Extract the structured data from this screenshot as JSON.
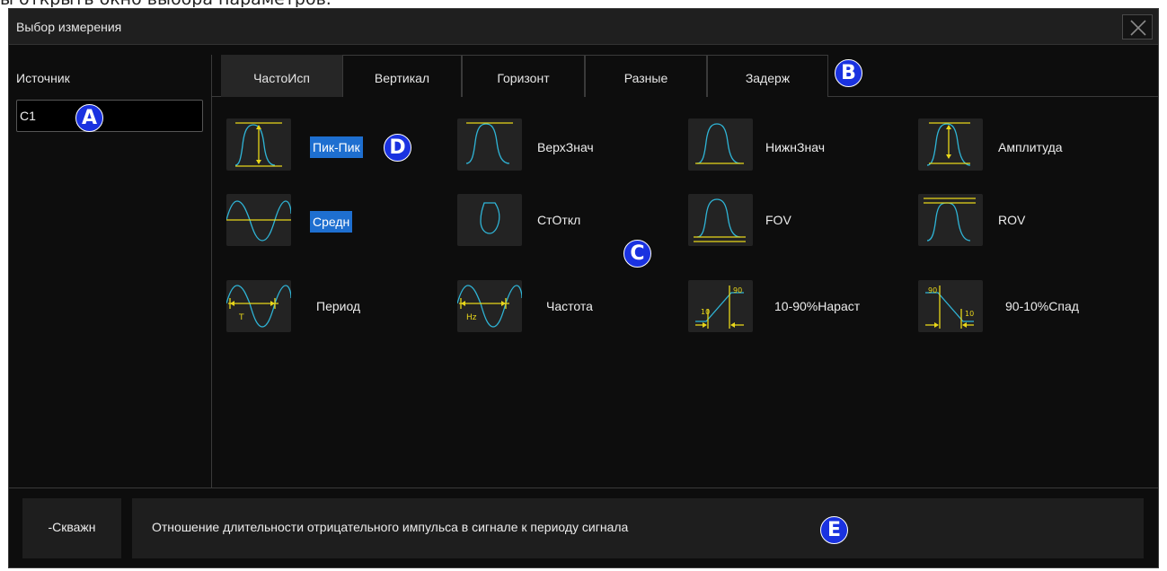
{
  "doc_snippet": "ы открыть окно выбора параметров.",
  "window": {
    "title": "Выбор измерения",
    "close_glyph": "✕"
  },
  "source": {
    "label": "Источник",
    "value": "C1"
  },
  "tabs": [
    {
      "label": "ЧастоИсп",
      "active": true
    },
    {
      "label": "Вертикал",
      "active": false
    },
    {
      "label": "Горизонт",
      "active": false
    },
    {
      "label": "Разные",
      "active": false
    },
    {
      "label": "Задерж",
      "active": false
    }
  ],
  "measurements": [
    {
      "label": "Пик-Пик",
      "icon": "peak-peak-icon",
      "selected": true
    },
    {
      "label": "ВерхЗнач",
      "icon": "top-value-icon",
      "selected": false
    },
    {
      "label": "НижнЗнач",
      "icon": "base-value-icon",
      "selected": false
    },
    {
      "label": "Амплитуда",
      "icon": "amplitude-icon",
      "selected": false
    },
    {
      "label": "Средн",
      "icon": "mean-icon",
      "selected": true
    },
    {
      "label": "СтОткл",
      "icon": "stdev-icon",
      "selected": false
    },
    {
      "label": "FOV",
      "icon": "fov-icon",
      "selected": false
    },
    {
      "label": "ROV",
      "icon": "rov-icon",
      "selected": false
    },
    {
      "label": "Период",
      "icon": "period-icon",
      "selected": false
    },
    {
      "label": "Частота",
      "icon": "frequency-icon",
      "selected": false
    },
    {
      "label": "10-90%Нараст",
      "icon": "rise-time-icon",
      "selected": false
    },
    {
      "label": "90-10%Спад",
      "icon": "fall-time-icon",
      "selected": false
    }
  ],
  "icon_text": {
    "period_t": "T",
    "freq_hz": "Hz",
    "p10": "10",
    "p90": "90"
  },
  "bottom": {
    "duty_label": "-Скважн",
    "description": "Отношение длительности отрицательного импульса в сигнале к периоду сигнала"
  },
  "markers": {
    "a": "A",
    "b": "B",
    "c": "C",
    "d": "D",
    "e": "E"
  },
  "colors": {
    "selection": "#1e6fd0",
    "marker": "#1a32e0",
    "waveform": "#2fb4d6",
    "guide": "#e8d61a",
    "background": "#0d0d0d"
  }
}
